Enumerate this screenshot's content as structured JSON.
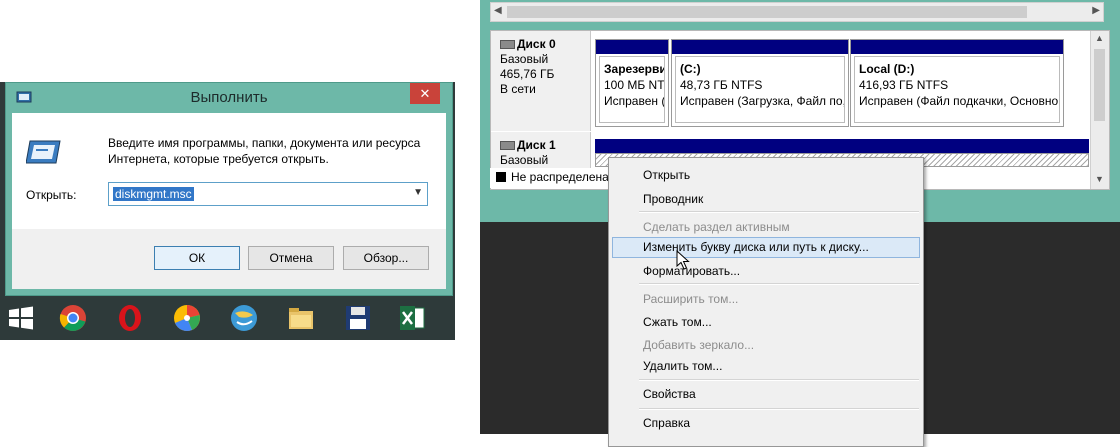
{
  "run_dialog": {
    "title": "Выполнить",
    "close": "✕",
    "description": "Введите имя программы, папки, документа или ресурса Интернета, которые требуется открыть.",
    "open_label": "Открыть:",
    "input_value": "diskmgmt.msc",
    "buttons": {
      "ok": "ОК",
      "cancel": "Отмена",
      "browse": "Обзор..."
    }
  },
  "taskbar": {
    "items": [
      "windows-logo-icon",
      "chrome-icon",
      "opera-icon",
      "picasa-icon",
      "browser-globe-icon",
      "file-explorer-icon",
      "floppy-save-icon",
      "excel-icon"
    ]
  },
  "disk_management": {
    "disks": [
      {
        "name": "Диск 0",
        "type": "Базовый",
        "size": "465,76 ГБ",
        "status": "В сети",
        "partitions": [
          {
            "name": "Зарезерви",
            "info": "100 МБ NTI",
            "status": "Исправен ("
          },
          {
            "name": "(C:)",
            "info": "48,73 ГБ NTFS",
            "status": "Исправен (Загрузка, Файл по,"
          },
          {
            "name": "Local  (D:)",
            "info": "416,93 ГБ NTFS",
            "status": "Исправен (Файл подкачки, Основно"
          }
        ]
      },
      {
        "name": "Диск 1",
        "type": "Базовый"
      }
    ],
    "legend": "Не распределена"
  },
  "context_menu": {
    "items": [
      {
        "label": "Открыть",
        "disabled": false
      },
      {
        "label": "Проводник",
        "disabled": false
      },
      {
        "label": "Сделать раздел активным",
        "disabled": true
      },
      {
        "label": "Изменить букву диска или путь к диску...",
        "disabled": false,
        "highlighted": true
      },
      {
        "label": "Форматировать...",
        "disabled": false
      },
      {
        "label": "Расширить том...",
        "disabled": true
      },
      {
        "label": "Сжать том...",
        "disabled": false
      },
      {
        "label": "Добавить зеркало...",
        "disabled": true
      },
      {
        "label": "Удалить том...",
        "disabled": false
      },
      {
        "label": "Свойства",
        "disabled": false
      },
      {
        "label": "Справка",
        "disabled": false
      }
    ]
  },
  "colors": {
    "window_frame": "#6db8a8",
    "partition_bar": "#000080",
    "close_button": "#c9433a",
    "selection": "#3277c8"
  }
}
